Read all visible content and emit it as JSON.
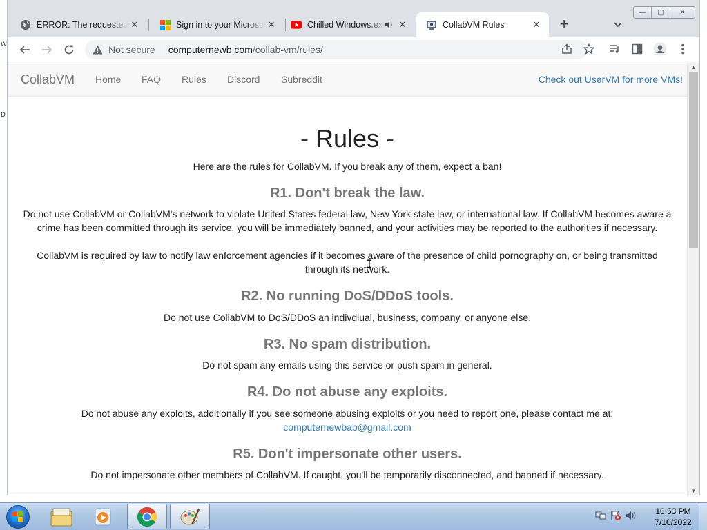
{
  "desktop": {
    "edge_text_1": "W",
    "edge_text_2": "D"
  },
  "tabs": [
    {
      "title": "ERROR: The requested URL could not be retrieved",
      "icon": "globe-icon",
      "close": "✕"
    },
    {
      "title": "Sign in to your Microsoft account",
      "icon": "microsoft-icon",
      "close": "✕"
    },
    {
      "title": "Chilled Windows.exe",
      "icon": "youtube-icon",
      "audio": "speaker-icon",
      "close": "✕"
    },
    {
      "title": "CollabVM Rules",
      "icon": "collabvm-icon",
      "close": "✕",
      "active": true
    }
  ],
  "window_controls": {
    "minimize": "—",
    "maximize": "▢",
    "close": "✕"
  },
  "toolbar": {
    "security_label": "Not secure",
    "url_host": "computernewb.com",
    "url_path": "/collab-vm/rules/"
  },
  "site": {
    "brand": "CollabVM",
    "nav": [
      "Home",
      "FAQ",
      "Rules",
      "Discord",
      "Subreddit"
    ],
    "nav_right": "Check out UserVM for more VMs!"
  },
  "page": {
    "title": "- Rules -",
    "intro": "Here are the rules for CollabVM. If you break any of them, expect a ban!",
    "rules": [
      {
        "heading": "R1. Don't break the law.",
        "paragraphs": [
          "Do not use CollabVM or CollabVM's network to violate United States federal law, New York state law, or international law. If CollabVM becomes aware a crime has been committed through its service, you will be immediately banned, and your activities may be reported to the authorities if necessary.",
          "CollabVM is required by law to notify law enforcement agencies if it becomes aware of the presence of child pornography on, or being transmitted through its network."
        ]
      },
      {
        "heading": "R2. No running DoS/DDoS tools.",
        "paragraphs": [
          "Do not use CollabVM to DoS/DDoS an indivdiual, business, company, or anyone else."
        ]
      },
      {
        "heading": "R3. No spam distribution.",
        "paragraphs": [
          "Do not spam any emails using this service or push spam in general."
        ]
      },
      {
        "heading": "R4. Do not abuse any exploits.",
        "paragraphs": [
          "Do not abuse any exploits, additionally if you see someone abusing exploits or you need to report one, please contact me at:"
        ],
        "email": "computernewbab@gmail.com"
      },
      {
        "heading": "R5. Don't impersonate other users.",
        "paragraphs": [
          "Do not impersonate other members of CollabVM. If caught, you'll be temporarily disconnected, and banned if necessary."
        ]
      }
    ]
  },
  "taskbar": {
    "apps": [
      "explorer-icon",
      "media-player-icon",
      "chrome-icon",
      "paint-icon"
    ],
    "tray_icons": [
      "network-icon",
      "flag-icon",
      "volume-icon"
    ],
    "time": "10:53 PM",
    "date": "7/10/2022"
  },
  "colors": {
    "link": "#337ab7",
    "navbar_bg": "#f8f8f8",
    "heading_gray": "#777777",
    "tab_strip": "#dee1e6"
  }
}
